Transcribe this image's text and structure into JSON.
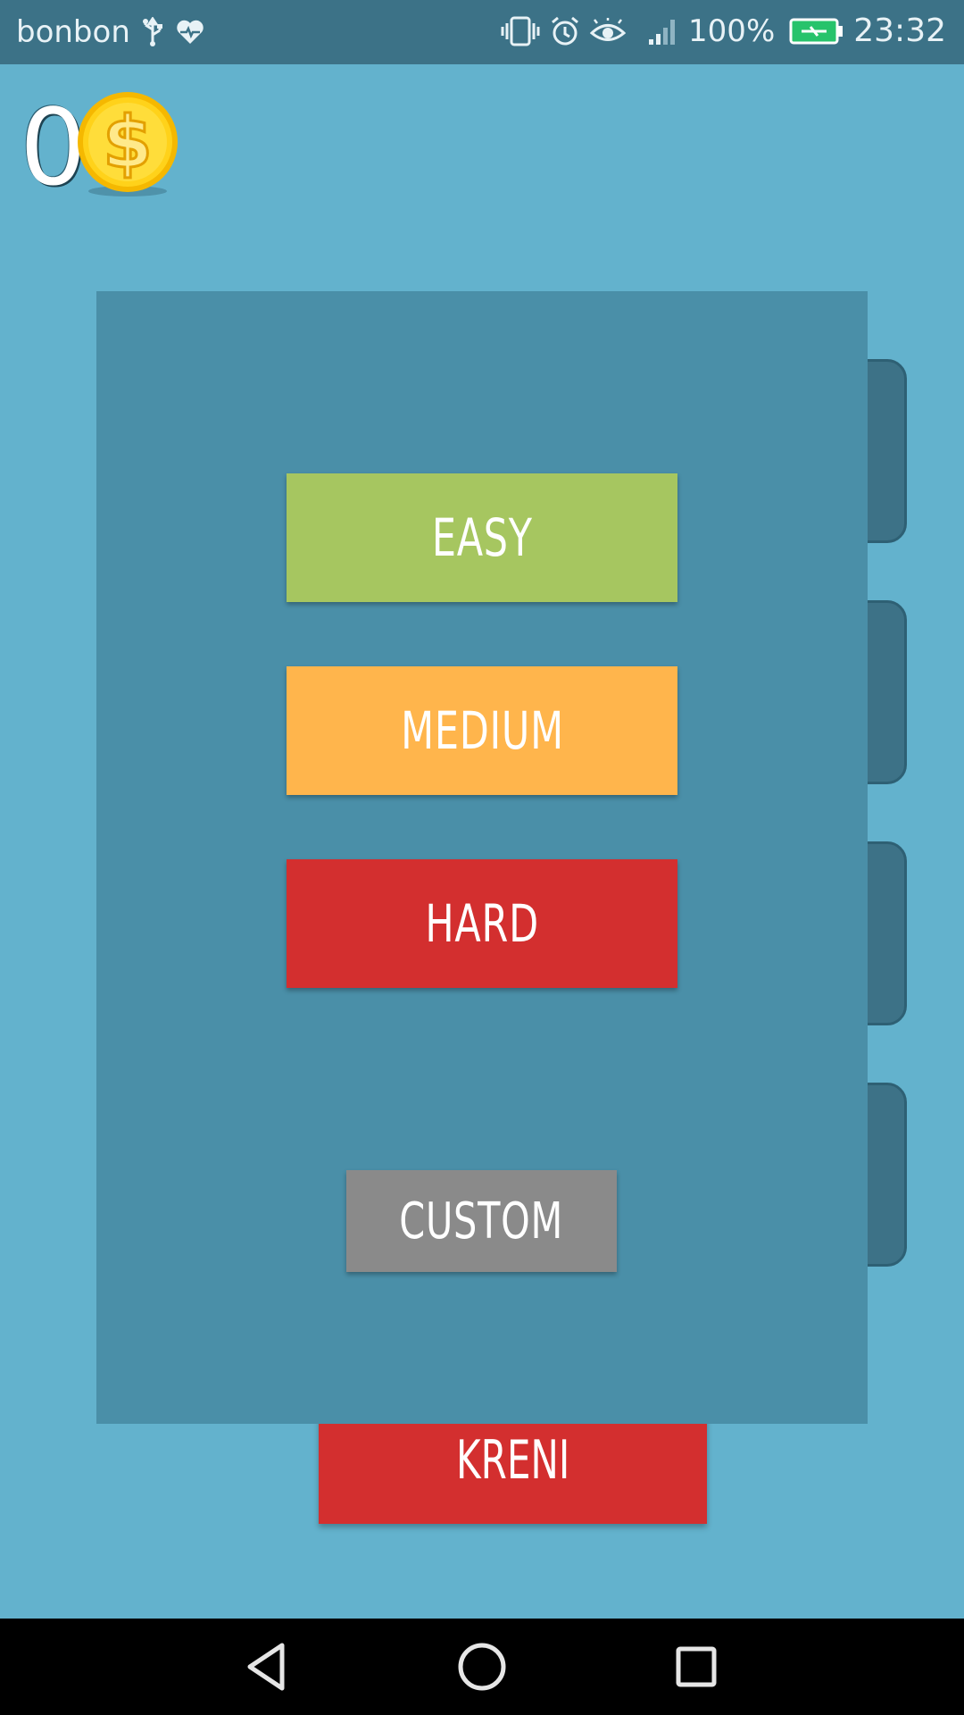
{
  "status_bar": {
    "carrier": "bonbon",
    "battery_percent": "100%",
    "time": "23:32",
    "icons": [
      "usb-icon",
      "health-icon",
      "vibrate-icon",
      "alarm-icon",
      "eye-icon",
      "signal-icon",
      "battery-charging-icon"
    ]
  },
  "header": {
    "coin_count": "0",
    "coin_icon": "dollar-coin-icon"
  },
  "dialog": {
    "buttons": {
      "easy": "EASY",
      "medium": "MEDIUM",
      "hard": "HARD",
      "custom": "CUSTOM"
    }
  },
  "main": {
    "start_button": "KRENI"
  },
  "nav_bar": {
    "icons": [
      "back-icon",
      "home-icon",
      "recents-icon"
    ]
  },
  "colors": {
    "background": "#63b2cd",
    "dialog": "#4a8fa8",
    "easy": "#a6c660",
    "medium": "#ffb54c",
    "hard": "#d32f2f",
    "custom": "#8a8a8a",
    "start": "#d32f2f"
  }
}
